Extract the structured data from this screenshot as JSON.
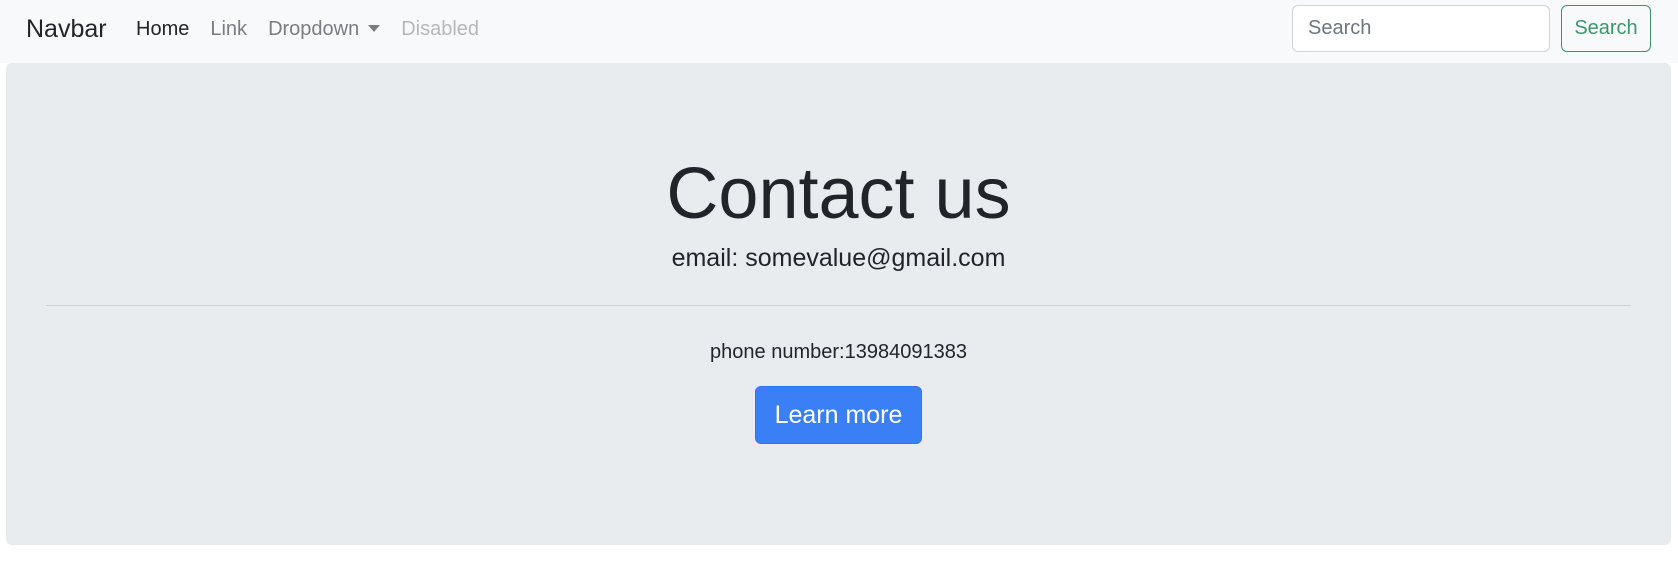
{
  "navbar": {
    "brand": "Navbar",
    "links": [
      {
        "label": "Home",
        "state": "active"
      },
      {
        "label": "Link",
        "state": "normal"
      },
      {
        "label": "Dropdown",
        "state": "normal"
      },
      {
        "label": "Disabled",
        "state": "disabled"
      }
    ],
    "search": {
      "placeholder": "Search",
      "value": "",
      "button_label": "Search"
    }
  },
  "main": {
    "title": "Contact us",
    "email_line": "email: somevalue@gmail.com",
    "phone_line": "phone number:13984091383",
    "button_label": "Learn more"
  },
  "colors": {
    "navbar_bg": "#f8f9fa",
    "jumbotron_bg": "#e9ecef",
    "primary": "#3a7ff6",
    "success": "#198754",
    "text": "#212529"
  },
  "icons": {
    "dropdown": "caret-down-icon"
  }
}
